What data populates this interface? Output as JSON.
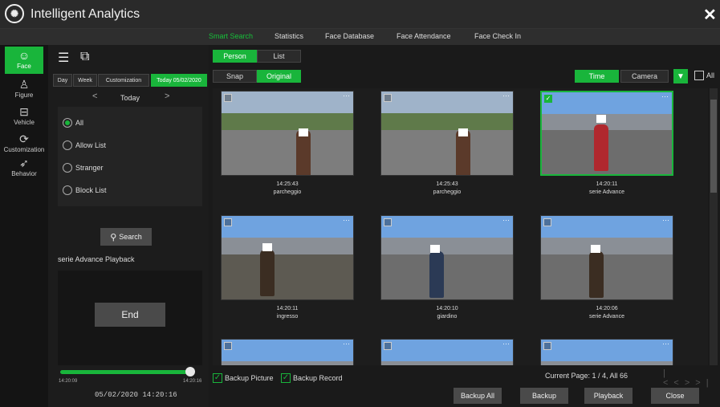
{
  "app": {
    "title": "Intelligent Analytics"
  },
  "tabs": [
    "Smart Search",
    "Statistics",
    "Face Database",
    "Face Attendance",
    "Face Check In"
  ],
  "nav": [
    {
      "label": "Face",
      "icon": "face-icon"
    },
    {
      "label": "Figure",
      "icon": "figure-icon"
    },
    {
      "label": "Vehicle",
      "icon": "vehicle-icon"
    },
    {
      "label": "Customization",
      "icon": "customization-icon"
    },
    {
      "label": "Behavior",
      "icon": "behavior-icon"
    }
  ],
  "period": {
    "day": "Day",
    "week": "Week",
    "custom": "Customization",
    "today_btn": "Today 05/02/2020",
    "nav_label": "Today",
    "prev": "<",
    "next": ">"
  },
  "filters": {
    "all": "All",
    "allow": "Allow List",
    "stranger": "Stranger",
    "block": "Block List"
  },
  "search": {
    "label": "Search"
  },
  "playback": {
    "title": "serie Advance Playback",
    "end": "End",
    "start_time": "14:20:09",
    "end_time": "14:20:16",
    "datetime": "05/02/2020 14:20:16"
  },
  "view": {
    "person": "Person",
    "list": "List",
    "snap": "Snap",
    "original": "Original",
    "time": "Time",
    "camera": "Camera",
    "all": "All"
  },
  "results": [
    {
      "time": "14:25:43",
      "camera": "parcheggio",
      "selected": false
    },
    {
      "time": "14:25:43",
      "camera": "parcheggio",
      "selected": false
    },
    {
      "time": "14:20:11",
      "camera": "serie Advance",
      "selected": true
    },
    {
      "time": "14:20:11",
      "camera": "ingresso",
      "selected": false
    },
    {
      "time": "14:20:10",
      "camera": "giardino",
      "selected": false
    },
    {
      "time": "14:20:06",
      "camera": "serie Advance",
      "selected": false
    }
  ],
  "footer": {
    "backup_picture": "Backup Picture",
    "backup_record": "Backup Record",
    "page_info": "Current Page: 1 / 4, All 66",
    "backup_all": "Backup All",
    "backup": "Backup",
    "playback": "Playback",
    "close": "Close"
  },
  "colors": {
    "accent": "#19b53b",
    "background": "#1a1a1a"
  }
}
